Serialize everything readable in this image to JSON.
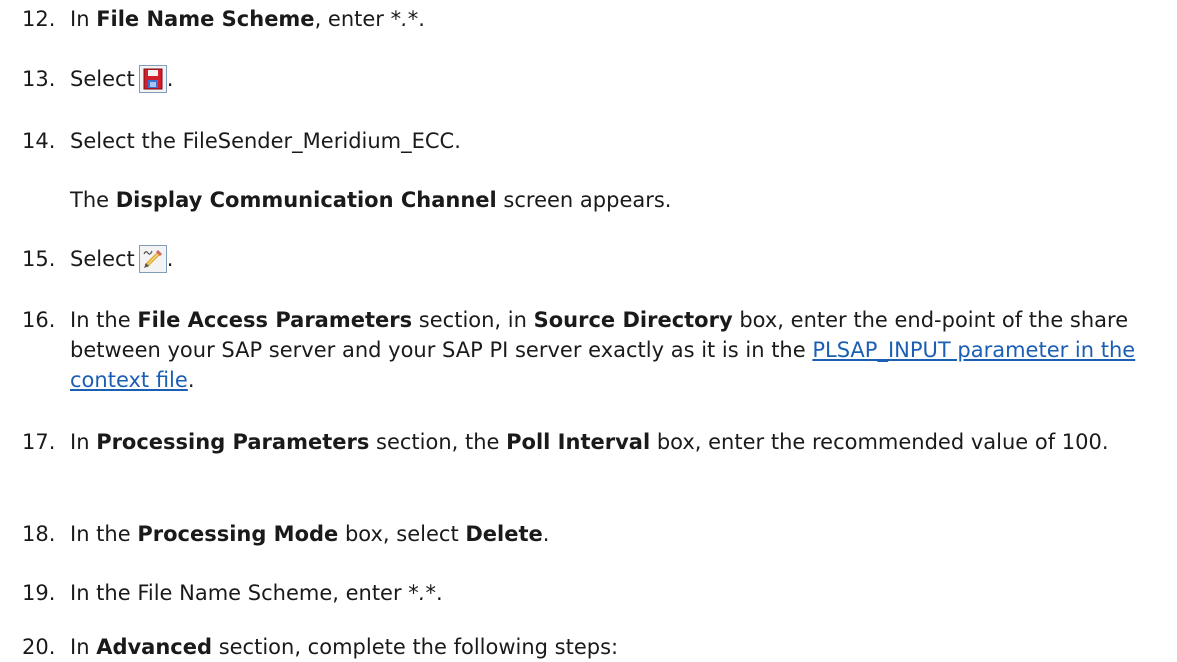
{
  "steps": [
    {
      "num": "12.",
      "a": "In ",
      "b": "File Name Scheme",
      "c": ", enter ",
      "d": "*.*",
      "e": "."
    },
    {
      "num": "13.",
      "a": "Select",
      "icon": "save-icon",
      "e": "."
    },
    {
      "num": "14.",
      "a": "Select the FileSender_Meridium_ECC.",
      "note_a": "The ",
      "note_b": "Display Communication Channel",
      "note_c": " screen appears."
    },
    {
      "num": "15.",
      "a": "Select",
      "icon": "edit-icon",
      "e": "."
    },
    {
      "num": "16.",
      "a": "In the ",
      "b": "File Access Parameters",
      "c": " section, in ",
      "d": "Source Directory",
      "e": " box, enter the end-point of the share between your SAP server and your SAP PI server exactly as it is in the ",
      "link": "PLSAP_INPUT parameter in the context file",
      "f": "."
    },
    {
      "num": "17.",
      "a": "In ",
      "b": "Processing Parameters",
      "c": " section, the ",
      "d": "Poll Interval",
      "e": " box, enter the recommended value of 100."
    },
    {
      "num": "18.",
      "a": "In the ",
      "b": "Processing Mode",
      "c": " box, select ",
      "d": "Delete",
      "e": "."
    },
    {
      "num": "19.",
      "a": "In the File Name Scheme, enter ",
      "d": "*.*",
      "e": "."
    },
    {
      "num": "20.",
      "a": "In ",
      "b": "Advanced",
      "c": " section, complete the following steps:"
    }
  ],
  "colors": {
    "link": "#1a5fb4",
    "text": "#1a1a1a"
  }
}
